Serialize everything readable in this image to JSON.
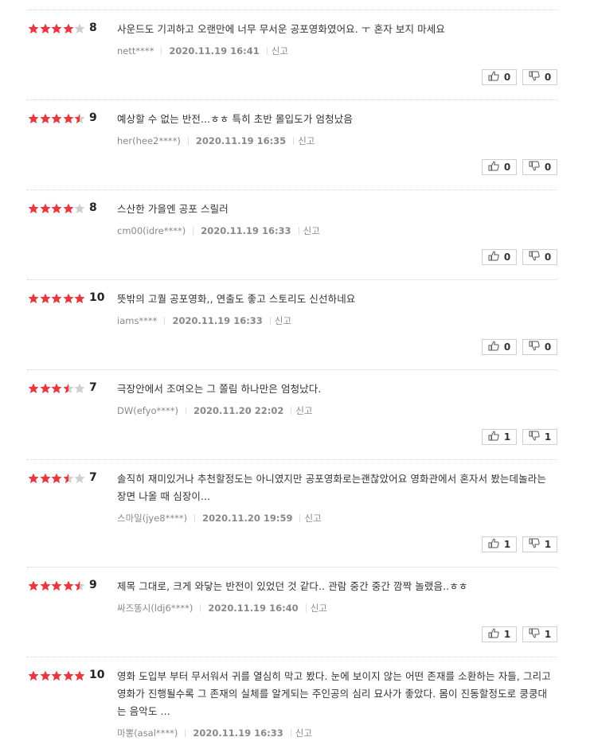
{
  "colors": {
    "star_filled": "#e8383d",
    "star_empty": "#cfcfcf",
    "divider": "#d6d6d6"
  },
  "report_label": "신고",
  "reviews": [
    {
      "rating": 4,
      "score": "8",
      "comment": "사운드도 기괴하고 오랜만에 너무 무서운 공포영화였어요. ㅜ 혼자 보지 마세요",
      "user": "nett****",
      "date": "2020.11.19 16:41",
      "likes": "0",
      "dislikes": "0"
    },
    {
      "rating": 4.5,
      "score": "9",
      "comment": "예상할 수 없는 반전...ㅎㅎ 특히 초반 몰입도가 엄청났음",
      "user": "her(hee2****)",
      "date": "2020.11.19 16:35",
      "likes": "0",
      "dislikes": "0"
    },
    {
      "rating": 4,
      "score": "8",
      "comment": "스산한 가을엔 공포 스릴러",
      "user": "cm00(idre****)",
      "date": "2020.11.19 16:33",
      "likes": "0",
      "dislikes": "0"
    },
    {
      "rating": 5,
      "score": "10",
      "comment": "뜻밖의 고퀄 공포영화,, 연출도 좋고 스토리도 신선하네요",
      "user": "iams****",
      "date": "2020.11.19 16:33",
      "likes": "0",
      "dislikes": "0"
    },
    {
      "rating": 3.5,
      "score": "7",
      "comment": "극장안에서 조여오는 그 쫄림 하나만은 엄청났다.",
      "user": "DW(efyo****)",
      "date": "2020.11.20 22:02",
      "likes": "1",
      "dislikes": "1"
    },
    {
      "rating": 3.5,
      "score": "7",
      "comment": "솔직히 재미있거나 추천할정도는 아니였지만 공포영화로는괜찮았어요 영화관에서 혼자서 봤는데놀라는 장면 나올 때 심장이...",
      "user": "스마일(jye8****)",
      "date": "2020.11.20 19:59",
      "likes": "1",
      "dislikes": "1"
    },
    {
      "rating": 4.5,
      "score": "9",
      "comment": "제목 그대로, 크게 와닿는 반전이 있었던 것 같다.. 관람 중간 중간 깜짝 놀랬음..ㅎㅎ",
      "user": "싸즈똥시(ldj6****)",
      "date": "2020.11.19 16:40",
      "likes": "1",
      "dislikes": "1"
    },
    {
      "rating": 5,
      "score": "10",
      "comment": "영화 도입부 부터 무서워서 귀를 열심히 막고 봤다. 눈에 보이지 않는 어떤 존재를 소환하는 자들, 그리고 영화가 진행될수록 그 존재의 실체를 알게되는 주인공의 심리 묘사가 좋았다. 몸이 진동할정도로 쿵쿵대는 음악도 ...",
      "user": "마뽕(asal****)",
      "date": "2020.11.19 16:33",
      "likes": null,
      "dislikes": null
    }
  ]
}
